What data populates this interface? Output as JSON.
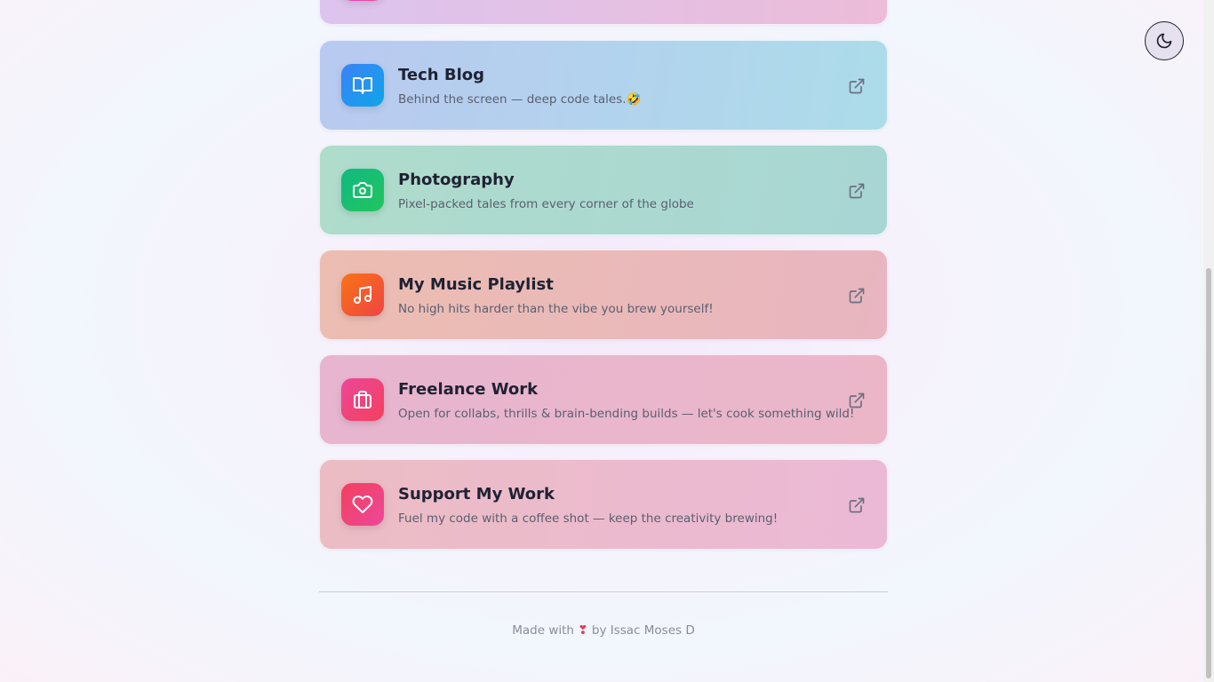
{
  "cards": [
    {
      "title": "Tech Blog",
      "description": "Behind the screen — deep code tales.🤣",
      "icon": "book-icon",
      "gradient": [
        "#3b82f6",
        "#0ea5e9"
      ],
      "background": [
        "#b9c9f0",
        "#acdcea"
      ]
    },
    {
      "title": "Photography",
      "description": "Pixel-packed tales from every corner of the globe",
      "icon": "camera-icon",
      "gradient": [
        "#10b981",
        "#22c55e"
      ],
      "background": [
        "#afdccb",
        "#a8d6d4"
      ]
    },
    {
      "title": "My Music Playlist",
      "description": "No high hits harder than the vibe you brew yourself!",
      "icon": "music-note-icon",
      "gradient": [
        "#f97316",
        "#ef4444"
      ],
      "background": [
        "#ecbdb1",
        "#e8b5c0"
      ]
    },
    {
      "title": "Freelance Work",
      "description": "Open for collabs, thrills & brain-bending builds — let's cook something wild!",
      "icon": "briefcase-icon",
      "gradient": [
        "#ec4899",
        "#f43f5e"
      ],
      "background": [
        "#e7b5d0",
        "#ebb6c8"
      ]
    },
    {
      "title": "Support My Work",
      "description": "Fuel my code with a coffee shot — keep the creativity brewing!",
      "icon": "heart-icon",
      "gradient": [
        "#f43f5e",
        "#ec4899"
      ],
      "background": [
        "#ecbcc4",
        "#ebb9d6"
      ]
    }
  ],
  "footer": {
    "prefix": "Made with",
    "heart": "❣",
    "suffix": "by Issac Moses D"
  },
  "theme_toggle": {
    "icon": "moon-icon"
  }
}
